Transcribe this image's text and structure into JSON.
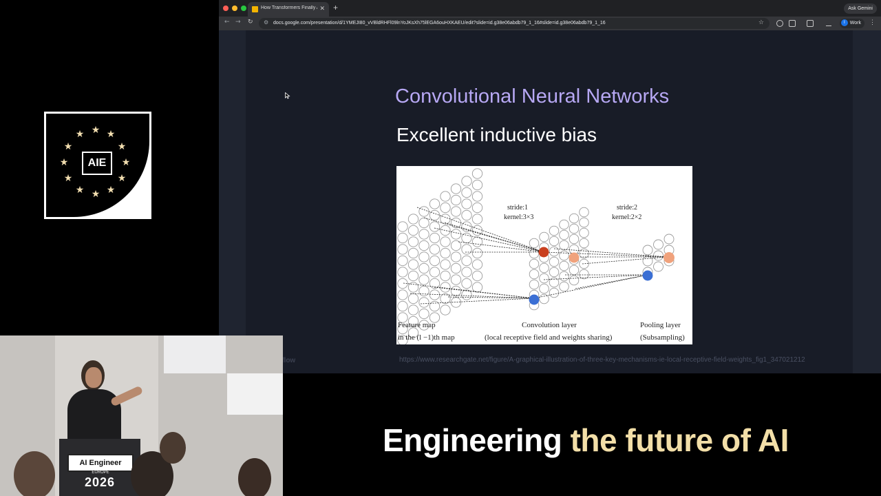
{
  "logo": {
    "text": "AIE",
    "star_glyph": "★",
    "star_color": "#f2deb0"
  },
  "browser": {
    "tab_title": "How Transformers Finally Ate",
    "tab_close": "✕",
    "new_tab": "+",
    "ask_gemini": "Ask Gemini",
    "url": "docs.google.com/presentation/d/1YMEJI80_vVBldRHFl09lnYoJKsXh75lEGA6ouHXKAEU/edit?slide=id.g38e06abdb79_1_16#slide=id.g38e06abdb79_1_16",
    "profile_initial": "I",
    "profile_label": "Work",
    "back_icon": "←",
    "forward_icon": "→",
    "reload_icon": "↻",
    "bookmark_icon": "☆",
    "menu_icon": "⋮"
  },
  "slide": {
    "title": "Convolutional Neural Networks",
    "subtitle": "Excellent inductive bias",
    "figure": {
      "label1": "stride:1",
      "label2": "kernel:3×3",
      "label3": "stride:2",
      "label4": "kernel:2×2",
      "caption_feature_line1": "Feature map",
      "caption_feature_line2": "in the (l −1)th map",
      "caption_conv_line1": "Convolution layer",
      "caption_conv_line2": "(local receptive field and weights sharing)",
      "caption_pool_line1": "Pooling layer",
      "caption_pool_line2": "(Subsampling)",
      "colors": {
        "red": "#c9401f",
        "orange": "#f0a27c",
        "blue": "#3b6fd4",
        "circle": "#9a9a9a"
      }
    },
    "brand": "roboflow",
    "source_url": "https://www.researchgate.net/figure/A-graphical-illustration-of-three-key-mechanisms-ie-local-receptive-field-weights_fig1_347021212"
  },
  "camera": {
    "podium_title": "AI Engineer",
    "podium_sub": "EUROPE",
    "podium_year": "2026"
  },
  "tagline": {
    "white": "Engineering",
    "gold": "the future of AI"
  }
}
